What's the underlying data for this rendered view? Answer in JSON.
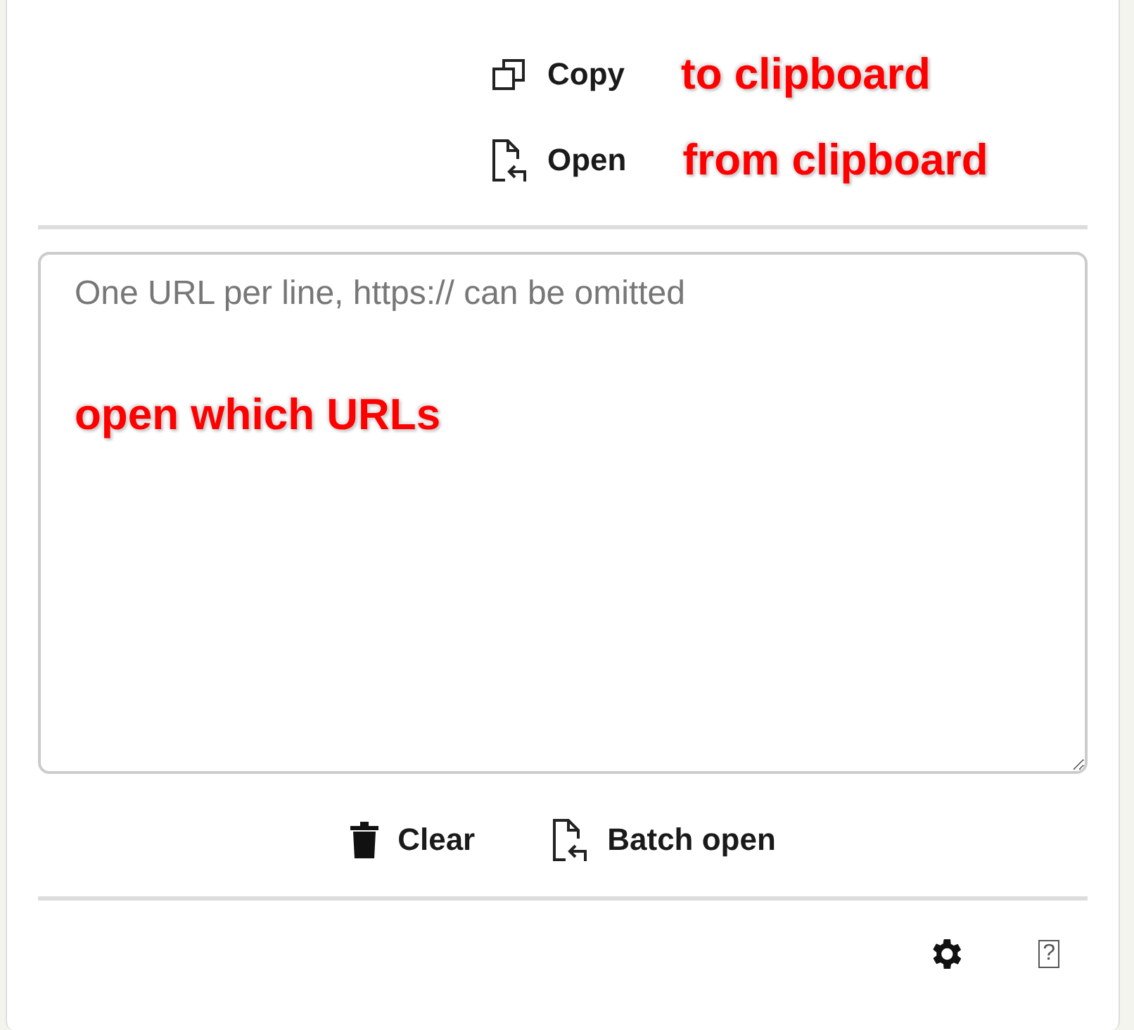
{
  "top_actions": [
    {
      "kind": "copy",
      "label": "Copy",
      "note": "to clipboard"
    },
    {
      "kind": "open",
      "label": "Open",
      "note": "from clipboard"
    }
  ],
  "url_box": {
    "placeholder": "One URL per line, https:// can be omitted",
    "note": "open which URLs"
  },
  "bottom_actions": [
    {
      "kind": "trash",
      "label": "Clear"
    },
    {
      "kind": "open",
      "label": "Batch open"
    }
  ],
  "footer": {
    "help": "?"
  }
}
